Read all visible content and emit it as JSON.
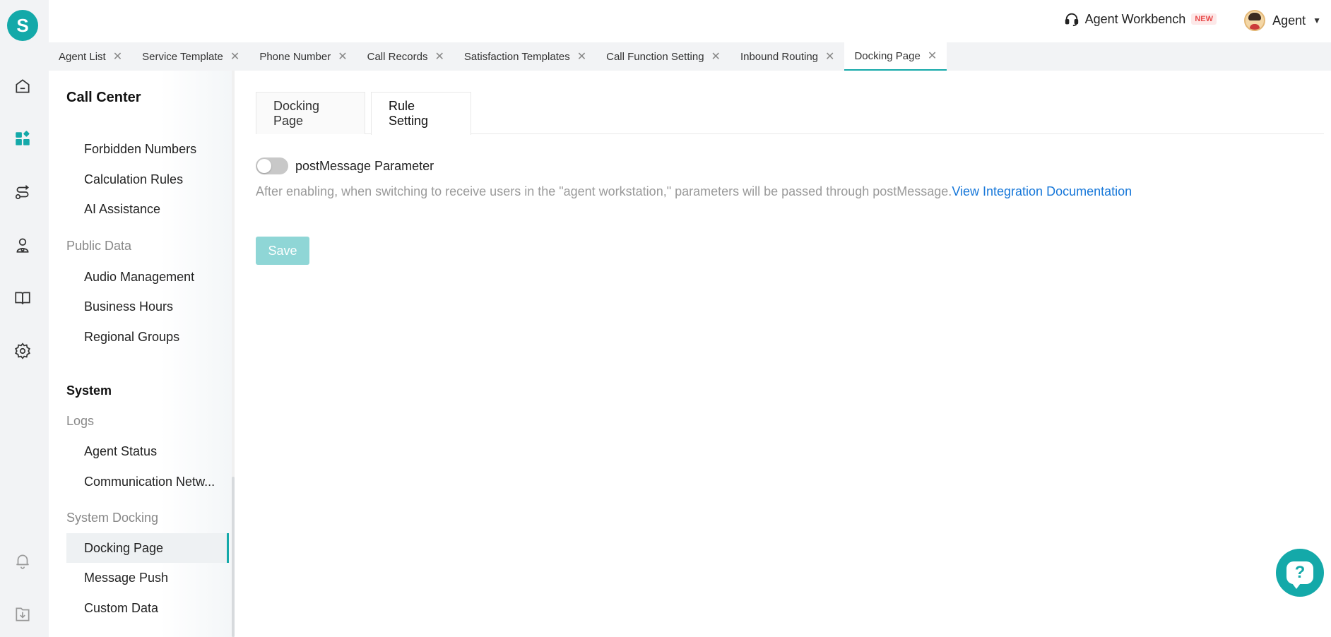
{
  "app": {
    "logo_letter": "S",
    "brand_color": "#14a9a9"
  },
  "rail": {
    "icons": [
      "home-icon",
      "apps-icon",
      "routing-icon",
      "agent-icon",
      "book-icon",
      "settings-icon",
      "bell-icon",
      "download-icon"
    ]
  },
  "header": {
    "workbench_label": "Agent Workbench",
    "workbench_badge": "NEW",
    "user_name": "Agent"
  },
  "tabs": [
    {
      "label": "Agent List"
    },
    {
      "label": "Service Template"
    },
    {
      "label": "Phone Number"
    },
    {
      "label": "Call Records"
    },
    {
      "label": "Satisfaction Templates"
    },
    {
      "label": "Call Function Setting"
    },
    {
      "label": "Inbound Routing"
    },
    {
      "label": "Docking Page",
      "active": true
    }
  ],
  "subnav": {
    "section_title": "Call Center",
    "items_a": [
      "Forbidden Numbers",
      "Calculation Rules",
      "AI Assistance"
    ],
    "group_public": "Public Data",
    "items_public": [
      "Audio Management",
      "Business Hours",
      "Regional Groups"
    ],
    "section_system": "System",
    "group_logs": "Logs",
    "items_logs": [
      "Agent Status",
      "Communication Netw..."
    ],
    "group_docking": "System Docking",
    "items_docking": [
      "Docking Page",
      "Message Push",
      "Custom Data"
    ]
  },
  "main": {
    "inner_tabs": [
      "Docking Page",
      "Rule Setting"
    ],
    "active_inner_tab": "Rule Setting",
    "toggle_label": "postMessage Parameter",
    "toggle_on": false,
    "description": "After enabling, when switching to receive users in the \"agent workstation,\" parameters will be passed through postMessage.",
    "doc_link": "View Integration Documentation",
    "save_label": "Save"
  },
  "help": {
    "glyph": "?"
  }
}
